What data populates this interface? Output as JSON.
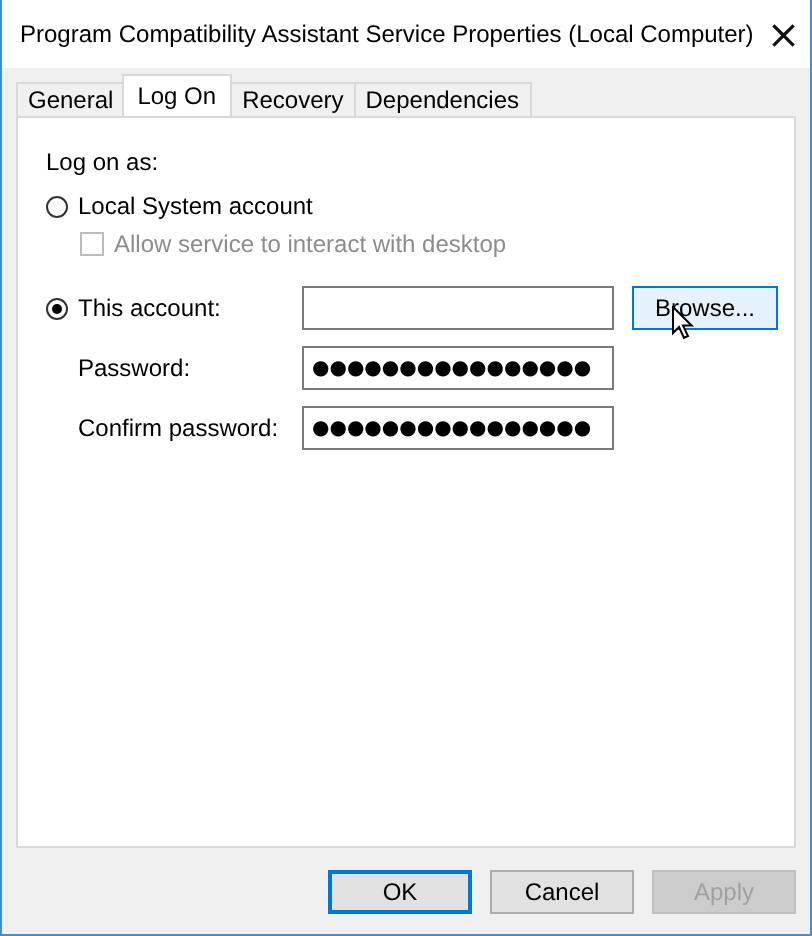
{
  "window": {
    "title": "Program Compatibility Assistant Service Properties (Local Computer)",
    "close": "×"
  },
  "tabs": [
    {
      "label": "General",
      "selected": false
    },
    {
      "label": "Log On",
      "selected": true
    },
    {
      "label": "Recovery",
      "selected": false
    },
    {
      "label": "Dependencies",
      "selected": false
    }
  ],
  "log_on": {
    "heading": "Log on as:",
    "options": [
      {
        "label": "Local System account",
        "selected": false
      },
      {
        "label": "This account:",
        "selected": true
      }
    ],
    "interact_checkbox": {
      "label": "Allow service to interact with desktop",
      "checked": false,
      "disabled": true
    },
    "browse_button": {
      "label": "Browse...",
      "hovered": true
    },
    "password": {
      "label": "Password:",
      "value": "●●●●●●●●●●●●●●●●"
    },
    "confirm_password": {
      "label": "Confirm password:",
      "value": "●●●●●●●●●●●●●●●●"
    }
  },
  "buttons": [
    {
      "label": "OK",
      "default": true,
      "disabled": false
    },
    {
      "label": "Cancel",
      "default": false,
      "disabled": false
    },
    {
      "label": "Apply",
      "default": false,
      "disabled": true
    }
  ]
}
